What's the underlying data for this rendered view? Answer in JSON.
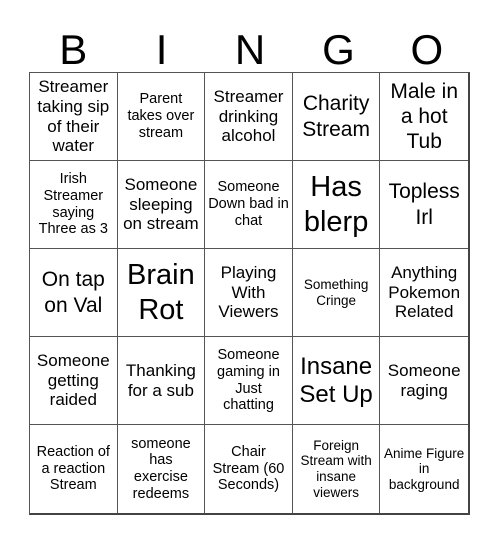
{
  "header": {
    "letters": [
      "B",
      "I",
      "N",
      "G",
      "O"
    ]
  },
  "cells": [
    {
      "text": "Streamer taking sip of their water",
      "size": "s-md"
    },
    {
      "text": "Parent takes over stream",
      "size": "s-sm"
    },
    {
      "text": "Streamer drinking alcohol",
      "size": "s-md"
    },
    {
      "text": "Charity Stream",
      "size": "s-lg"
    },
    {
      "text": "Male in a hot Tub",
      "size": "s-lg"
    },
    {
      "text": "Irish Streamer saying Three as 3",
      "size": "s-sm"
    },
    {
      "text": "Someone sleeping on stream",
      "size": "s-md"
    },
    {
      "text": "Someone Down bad in chat",
      "size": "s-sm"
    },
    {
      "text": "Has blerp",
      "size": "s-xxl"
    },
    {
      "text": "Topless Irl",
      "size": "s-lg"
    },
    {
      "text": "On tap on Val",
      "size": "s-lg"
    },
    {
      "text": "Brain Rot",
      "size": "s-xxl"
    },
    {
      "text": "Playing With Viewers",
      "size": "s-md"
    },
    {
      "text": "Something Cringe",
      "size": "s-xs"
    },
    {
      "text": "Anything Pokemon Related",
      "size": "s-md"
    },
    {
      "text": "Someone getting raided",
      "size": "s-md"
    },
    {
      "text": "Thanking for a sub",
      "size": "s-md"
    },
    {
      "text": "Someone gaming in Just chatting",
      "size": "s-sm"
    },
    {
      "text": "Insane Set Up",
      "size": "s-xl"
    },
    {
      "text": "Someone raging",
      "size": "s-md"
    },
    {
      "text": "Reaction of a reaction Stream",
      "size": "s-sm"
    },
    {
      "text": "someone has exercise redeems",
      "size": "s-sm"
    },
    {
      "text": "Chair Stream (60 Seconds)",
      "size": "s-sm"
    },
    {
      "text": "Foreign Stream with insane viewers",
      "size": "s-xs"
    },
    {
      "text": "Anime Figure in background",
      "size": "s-xs"
    }
  ]
}
